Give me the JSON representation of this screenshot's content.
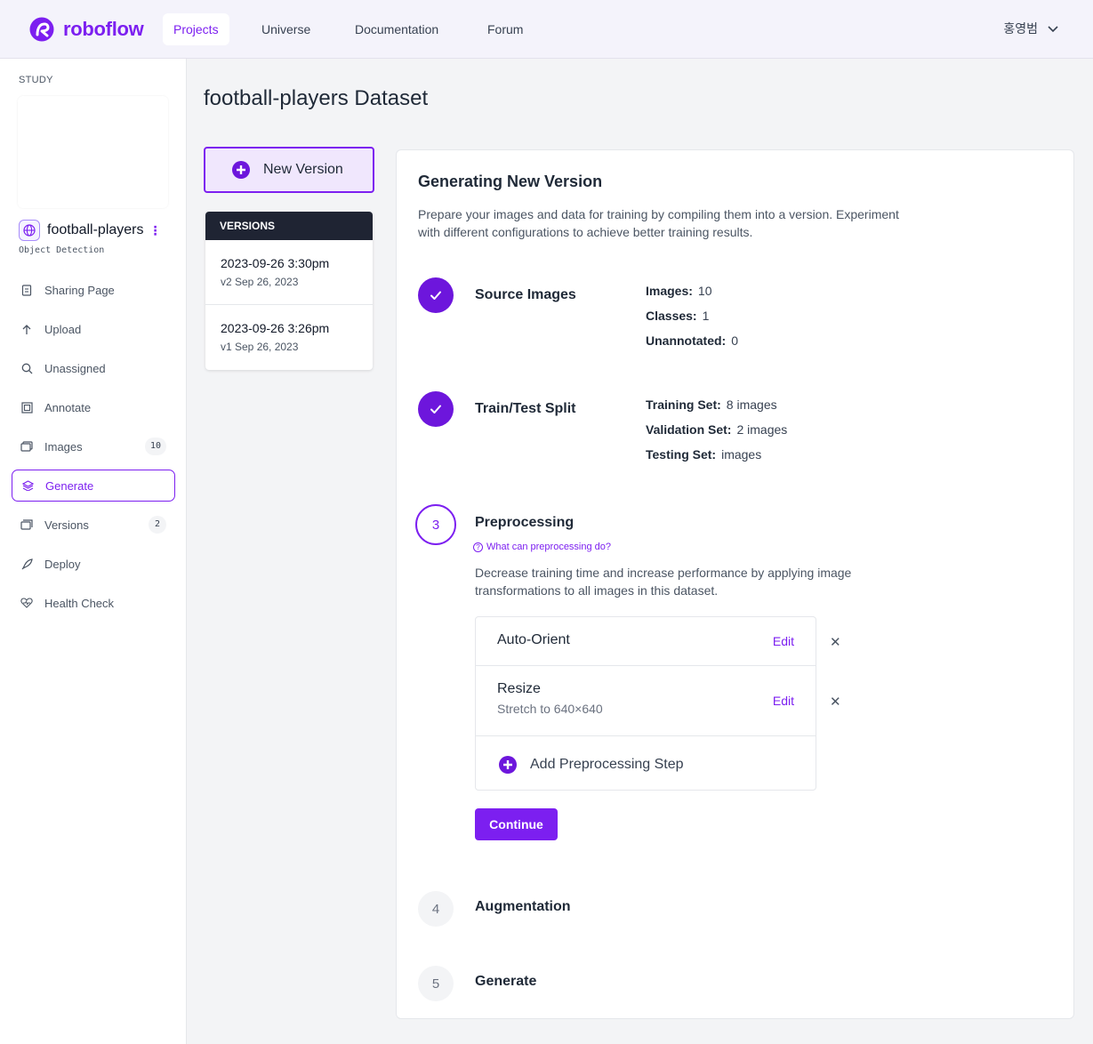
{
  "brand": {
    "name": "roboflow",
    "color": "#7c1ff0"
  },
  "nav": {
    "tabs": [
      "Projects",
      "Universe",
      "Documentation",
      "Forum"
    ],
    "active_tab": "Projects",
    "user_name": "홍영범"
  },
  "sidebar": {
    "workspace_label": "STUDY",
    "project_name": "football-players",
    "project_type": "Object Detection",
    "items": [
      {
        "label": "Sharing Page",
        "icon": "document-icon"
      },
      {
        "label": "Upload",
        "icon": "arrow-up-icon"
      },
      {
        "label": "Unassigned",
        "icon": "search-icon"
      },
      {
        "label": "Annotate",
        "icon": "annotate-frame-icon"
      },
      {
        "label": "Images",
        "icon": "images-icon",
        "count": "10"
      },
      {
        "label": "Generate",
        "icon": "layers-icon",
        "active": true
      },
      {
        "label": "Versions",
        "icon": "versions-icon",
        "count": "2"
      },
      {
        "label": "Deploy",
        "icon": "rocket-icon"
      },
      {
        "label": "Health Check",
        "icon": "heart-pulse-icon"
      }
    ]
  },
  "main": {
    "page_title": "football-players Dataset",
    "new_version_label": "New Version",
    "versions_header": "VERSIONS",
    "versions": [
      {
        "name": "2023-09-26 3:30pm",
        "meta": "v2 Sep 26, 2023"
      },
      {
        "name": "2023-09-26 3:26pm",
        "meta": "v1 Sep 26, 2023"
      }
    ]
  },
  "generator": {
    "title": "Generating New Version",
    "description": "Prepare your images and data for training by compiling them into a version. Experiment with different configurations to achieve better training results.",
    "steps": {
      "source": {
        "title": "Source Images",
        "stats": [
          {
            "label": "Images:",
            "value": "10"
          },
          {
            "label": "Classes:",
            "value": "1"
          },
          {
            "label": "Unannotated:",
            "value": "0"
          }
        ]
      },
      "split": {
        "title": "Train/Test Split",
        "stats": [
          {
            "label": "Training Set:",
            "value": "8 images"
          },
          {
            "label": "Validation Set:",
            "value": "2 images"
          },
          {
            "label": "Testing Set:",
            "value": "images"
          }
        ]
      },
      "preprocessing": {
        "number": "3",
        "title": "Preprocessing",
        "help_link": "What can preprocessing do?",
        "description": "Decrease training time and increase performance by applying image transformations to all images in this dataset.",
        "items": [
          {
            "name": "Auto-Orient",
            "detail": "",
            "edit_label": "Edit"
          },
          {
            "name": "Resize",
            "detail": "Stretch to 640×640",
            "edit_label": "Edit"
          }
        ],
        "add_step_label": "Add Preprocessing Step",
        "continue_label": "Continue"
      },
      "augmentation": {
        "number": "4",
        "title": "Augmentation"
      },
      "generate": {
        "number": "5",
        "title": "Generate"
      }
    }
  }
}
